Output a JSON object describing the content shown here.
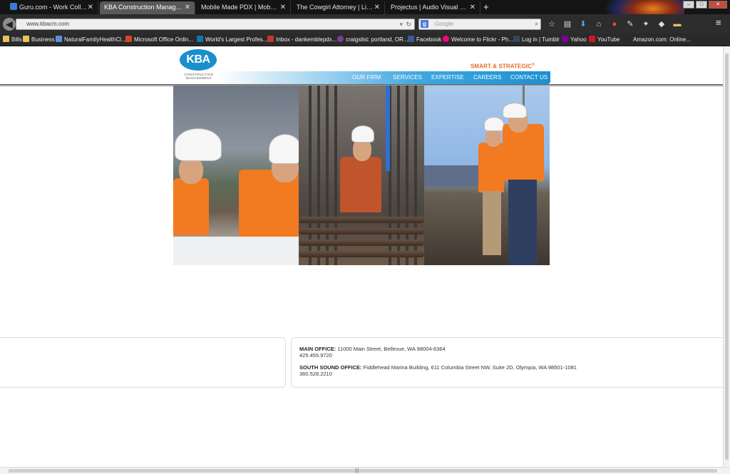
{
  "browser": {
    "tabs": [
      {
        "title": "Guru.com - Work Collectio...",
        "active": false,
        "icon_color": "#3a7bd5"
      },
      {
        "title": "KBA Construction Managemen...",
        "active": true,
        "icon_color": ""
      },
      {
        "title": "Mobile Made PDX | Mobile Ma...",
        "active": false,
        "icon_color": ""
      },
      {
        "title": "The Cowgirl Attorney | Lighthe...",
        "active": false,
        "icon_color": ""
      },
      {
        "title": "Projectus | Audio Visual System...",
        "active": false,
        "icon_color": ""
      }
    ],
    "new_tab": "+",
    "url": "www.kbacm.com",
    "search_placeholder": "Google",
    "bookmarks": [
      {
        "label": "Bills",
        "icon": "folder-icon",
        "color": "#e8c25a"
      },
      {
        "label": "Business",
        "icon": "folder-icon",
        "color": "#e8c25a"
      },
      {
        "label": "NaturalFamilyHealthCl...",
        "icon": "site-icon",
        "color": "#5b8fd6"
      },
      {
        "label": "Microsoft Office Onlin...",
        "icon": "office-icon",
        "color": "#d24726"
      },
      {
        "label": "World's Largest Profes...",
        "icon": "linkedin-icon",
        "color": "#0e76a8"
      },
      {
        "label": "Inbox - dankemblepdx...",
        "icon": "mail-icon",
        "color": "#c0392b"
      },
      {
        "label": "craigslist: portland, OR...",
        "icon": "peace-icon",
        "color": "#7d3c98"
      },
      {
        "label": "Facebook",
        "icon": "facebook-icon",
        "color": "#3b5998"
      },
      {
        "label": "Welcome to Flickr - Ph...",
        "icon": "flickr-icon",
        "color": "#ff0084"
      },
      {
        "label": "Log in | Tumblr",
        "icon": "tumblr-icon",
        "color": "#35465c"
      },
      {
        "label": "Yahoo",
        "icon": "yahoo-icon",
        "color": "#7b0099"
      },
      {
        "label": "YouTube",
        "icon": "youtube-icon",
        "color": "#cc181e"
      },
      {
        "label": "Amazon.com: Online...",
        "icon": "amazon-icon",
        "color": "#ff9900"
      }
    ]
  },
  "site": {
    "logo_text": "KBA",
    "logo_subtitle": "CONSTRUCTION MANAGEMENT",
    "tagline": "SMART & STRATEGIC",
    "tagline_mark": "®",
    "nav": [
      "OUR FIRM",
      "SERVICES",
      "EXPERTISE",
      "CAREERS",
      "CONTACT US"
    ],
    "offices": [
      {
        "label": "MAIN OFFICE:",
        "address": "11000 Main Street, Bellevue, WA 98004-6364",
        "phone": "425.455.9720"
      },
      {
        "label": "SOUTH SOUND OFFICE:",
        "address": "Fiddlehead Marina Building, 611 Columbia Street NW, Suite 2D, Olympia, WA 98501-1081",
        "phone": "360.528.2210"
      }
    ]
  },
  "colors": {
    "brand_blue": "#1b8fcc",
    "accent_orange": "#e96a1e"
  }
}
